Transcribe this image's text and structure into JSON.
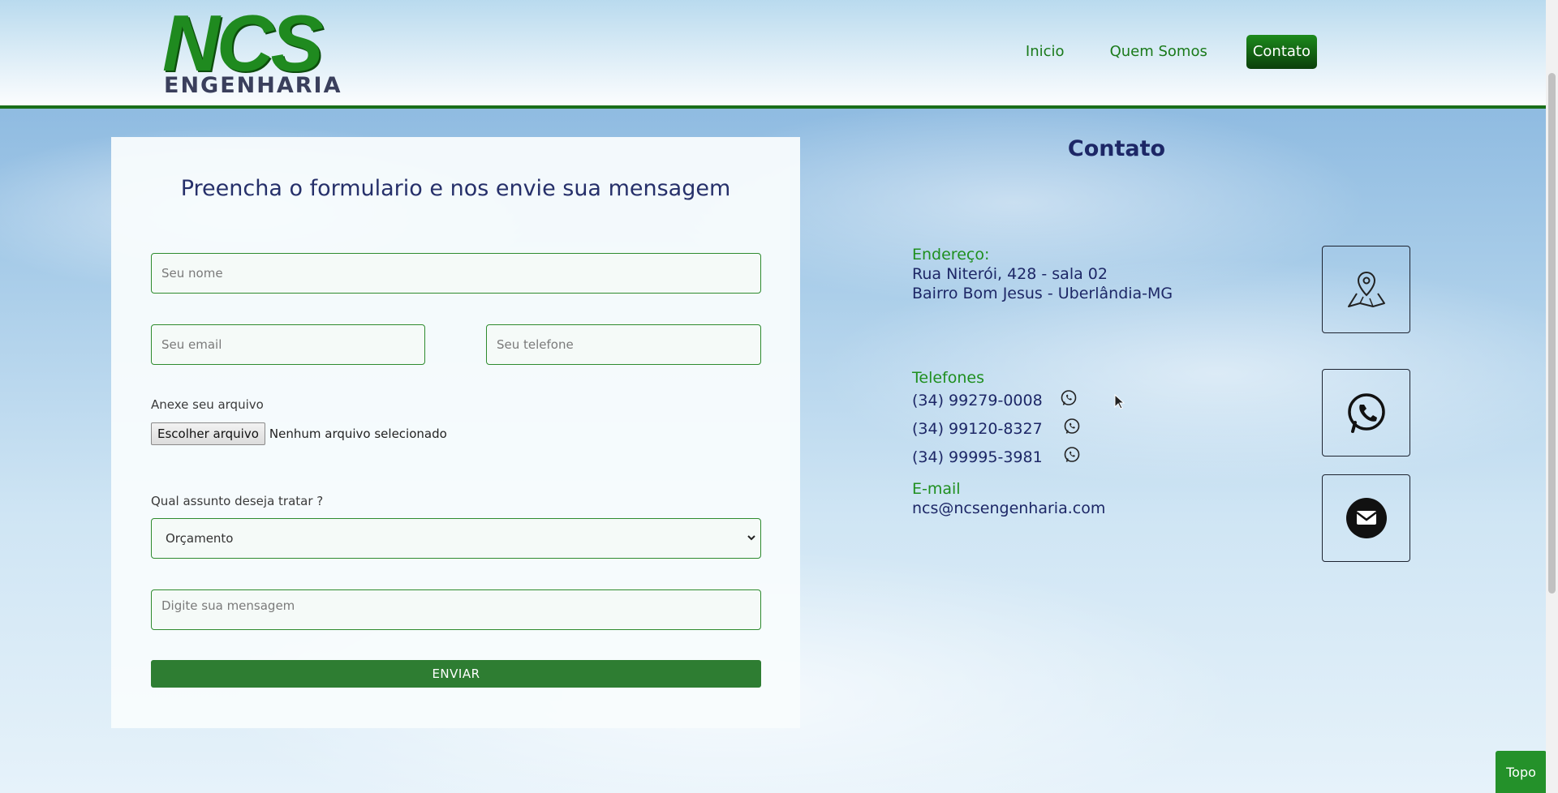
{
  "header": {
    "logo": {
      "main": "NCS",
      "sub": "ENGENHARIA"
    },
    "nav": [
      {
        "label": "Inicio",
        "active": false
      },
      {
        "label": "Quem Somos",
        "active": false
      },
      {
        "label": "Contato",
        "active": true
      }
    ]
  },
  "form": {
    "title": "Preencha o formulario e nos envie sua mensagem",
    "name_placeholder": "Seu nome",
    "email_placeholder": "Seu email",
    "phone_placeholder": "Seu telefone",
    "file_label": "Anexe seu arquivo",
    "file_button": "Escolher arquivo",
    "file_status": "Nenhum arquivo selecionado",
    "subject_label": "Qual assunto deseja tratar ?",
    "subject_selected": "Orçamento",
    "message_placeholder": "Digite sua mensagem",
    "submit_label": "ENVIAR"
  },
  "contact": {
    "title": "Contato",
    "address_label": "Endereço:",
    "address_line1": "Rua Niterói, 428 - sala 02",
    "address_line2": "Bairro Bom Jesus - Uberlândia-MG",
    "phones_label": "Telefones",
    "phones": [
      "(34) 99279-0008",
      "(34) 99120-8327",
      "(34) 99995-3981"
    ],
    "email_label": "E-mail",
    "email": "ncs@ncsengenharia.com",
    "icons": [
      "map-pin-icon",
      "whatsapp-icon",
      "email-icon"
    ]
  },
  "top_button": "Topo",
  "colors": {
    "brand_green": "#1f8a1f",
    "dark_green": "#0b3f0b",
    "navy": "#1d2766",
    "button_green": "#2e7d32"
  }
}
